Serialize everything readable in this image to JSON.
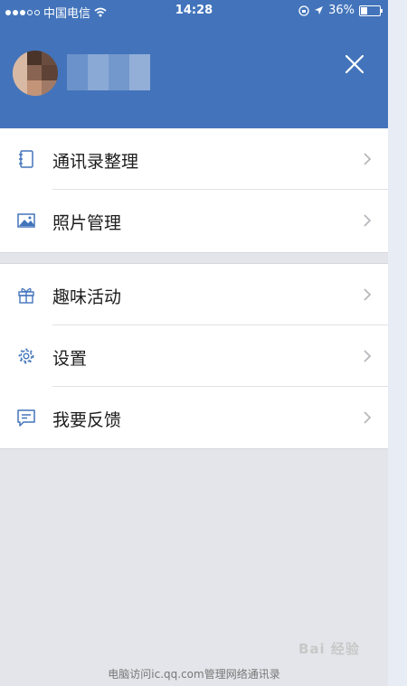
{
  "status_bar": {
    "carrier": "中国电信",
    "time": "14:28",
    "battery": "36%"
  },
  "header": {
    "close_icon": "close-icon",
    "background_color": "#4374bb"
  },
  "menu": {
    "group1": [
      {
        "label": "通讯录整理",
        "icon": "address-book-icon"
      },
      {
        "label": "照片管理",
        "icon": "photo-icon"
      }
    ],
    "group2": [
      {
        "label": "趣味活动",
        "icon": "gift-icon"
      },
      {
        "label": "设置",
        "icon": "gear-icon"
      },
      {
        "label": "我要反馈",
        "icon": "message-icon"
      }
    ]
  },
  "footer": {
    "text": "电脑访问ic.qq.com管理网络通讯录"
  },
  "watermark": {
    "text": "Bai  经验"
  }
}
